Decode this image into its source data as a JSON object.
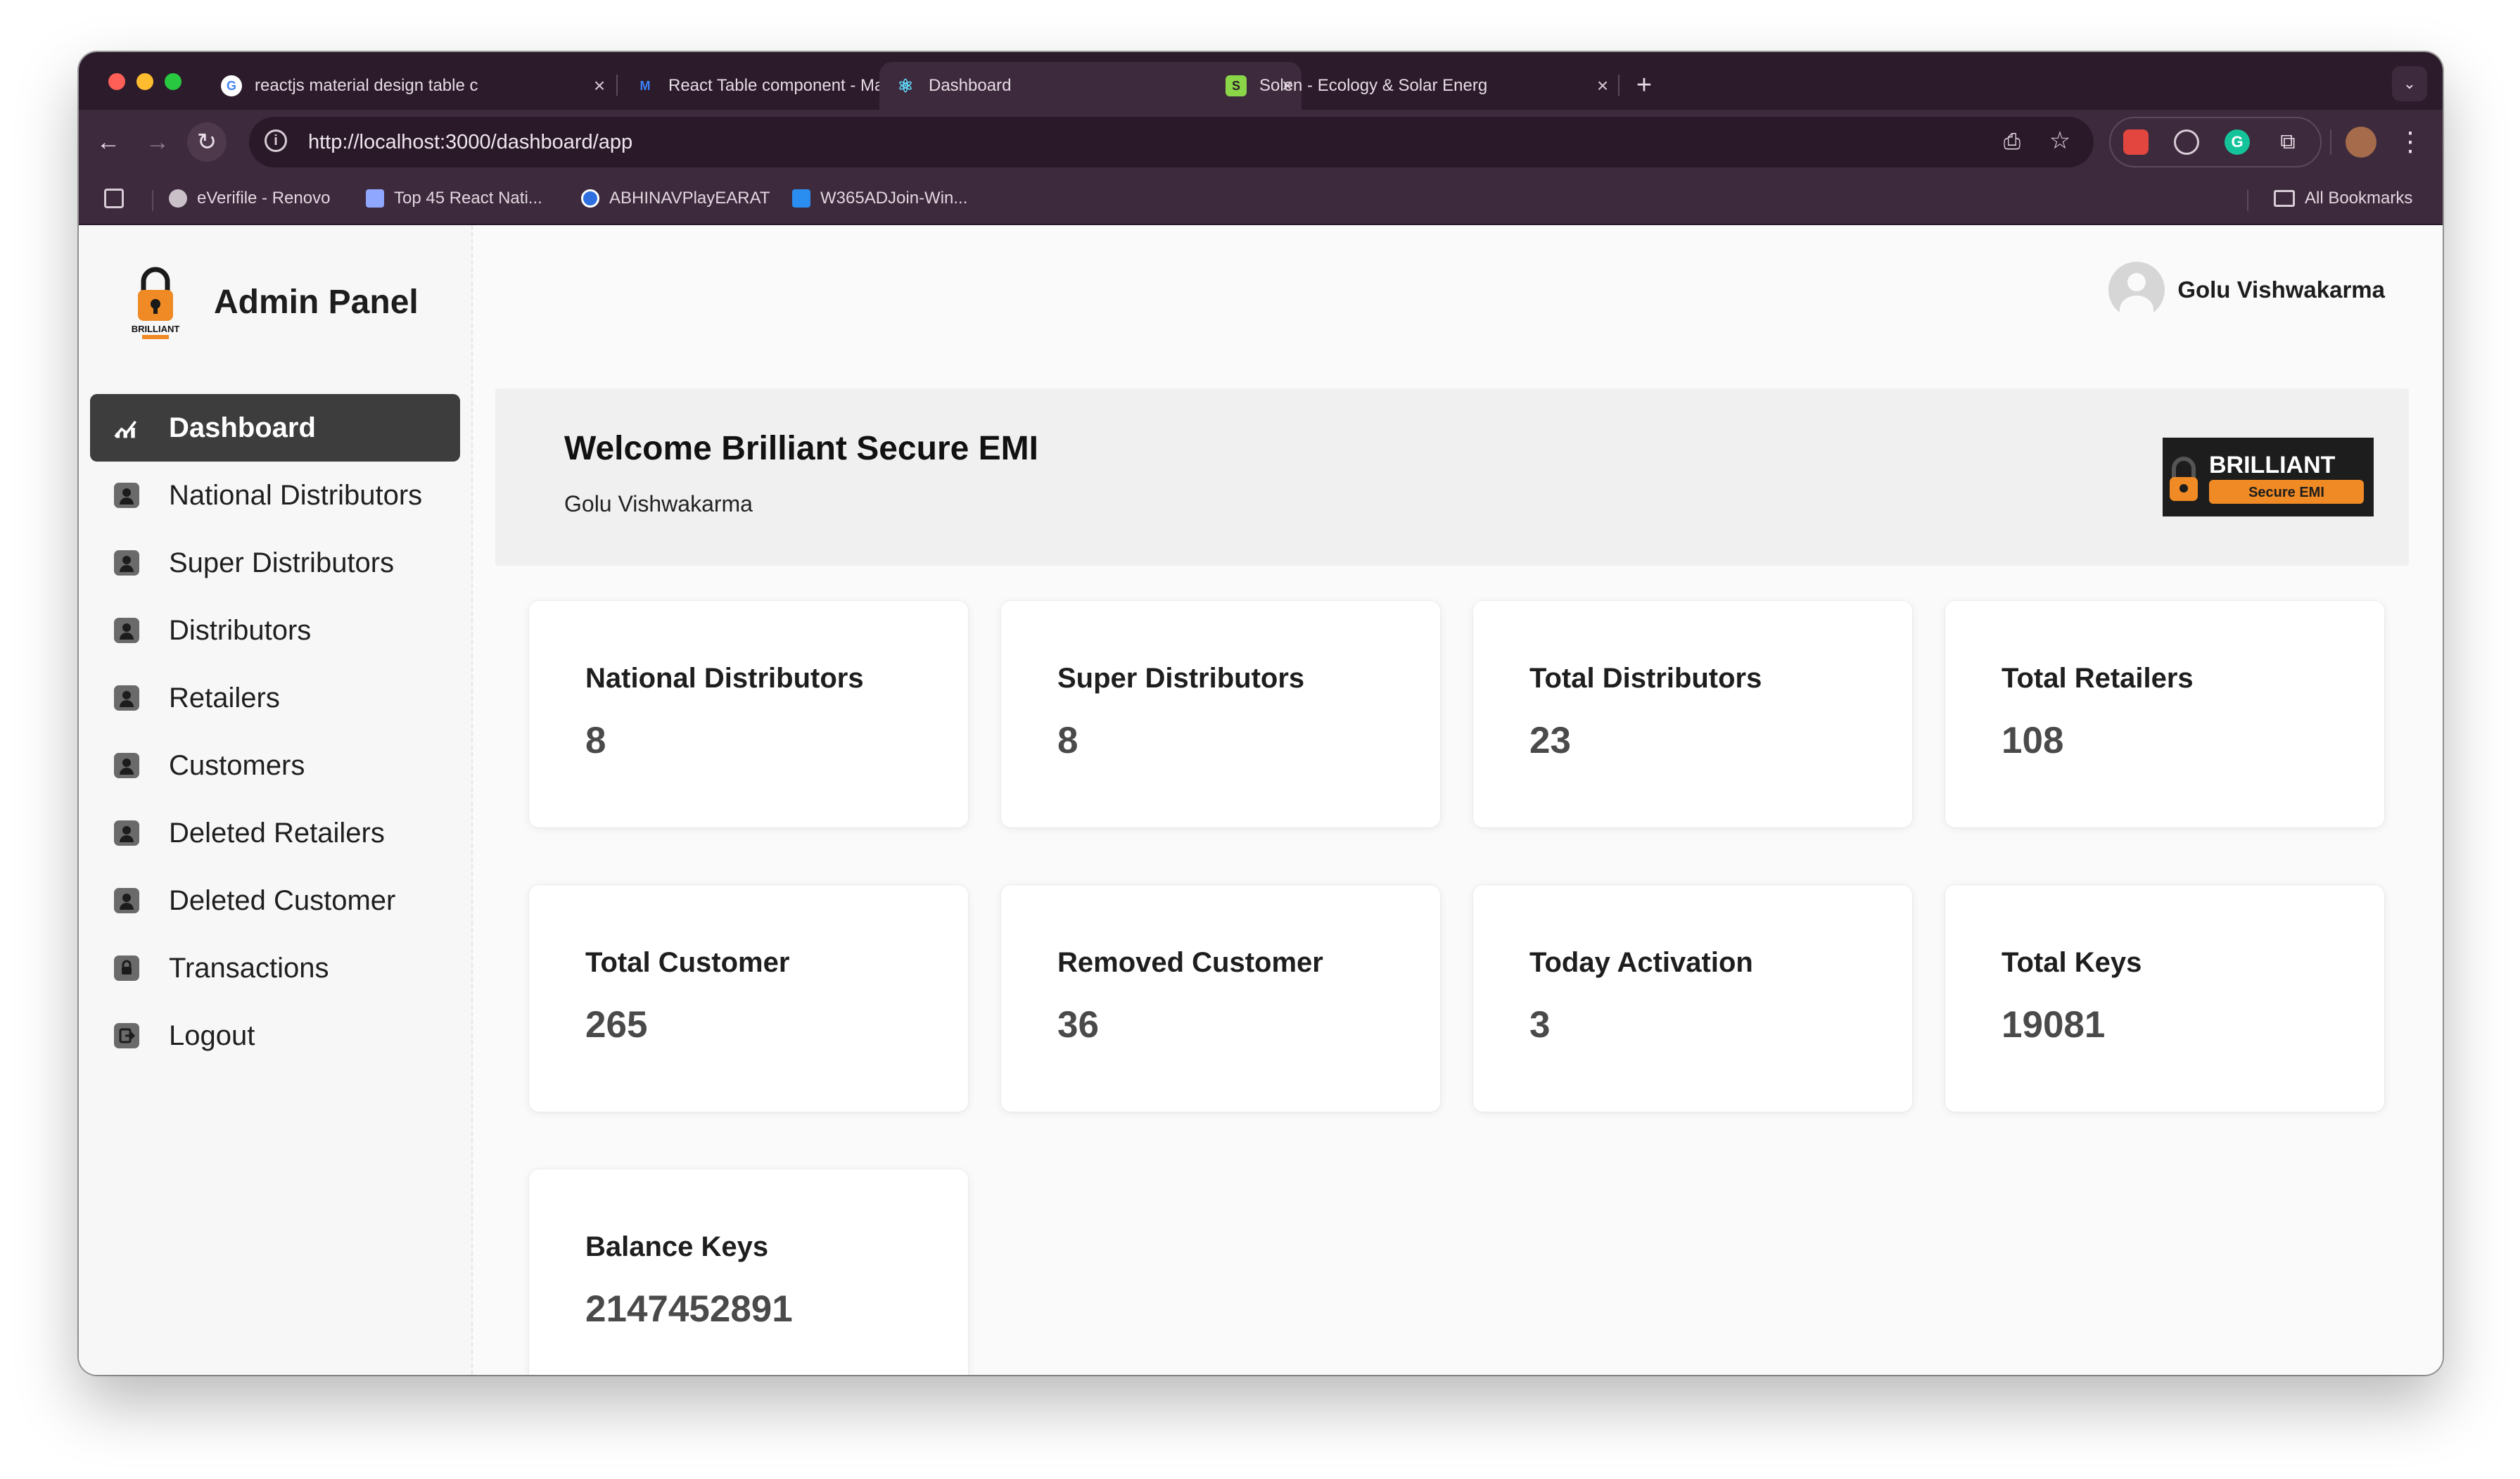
{
  "browser": {
    "tabs": [
      {
        "title": "reactjs material design table c",
        "favicon": "google-icon"
      },
      {
        "title": "React Table component - Mat",
        "favicon": "mui-icon"
      },
      {
        "title": "Dashboard",
        "favicon": "react-icon",
        "active": true
      },
      {
        "title": "Solen - Ecology & Solar Energ",
        "favicon": "solen-icon"
      }
    ],
    "url": "http://localhost:3000/dashboard/app",
    "bookmarks": [
      "eVerifile - Renovo",
      "Top 45 React Nati...",
      "ABHINAVPlayEARAT",
      "W365ADJoin-Win..."
    ],
    "all_bookmarks_label": "All Bookmarks"
  },
  "sidebar": {
    "title": "Admin Panel",
    "logo_text": "BRILLIANT",
    "items": [
      {
        "label": "Dashboard",
        "icon": "chart-icon",
        "active": true
      },
      {
        "label": "National Distributors",
        "icon": "person-icon"
      },
      {
        "label": "Super Distributors",
        "icon": "person-icon"
      },
      {
        "label": "Distributors",
        "icon": "person-icon"
      },
      {
        "label": "Retailers",
        "icon": "person-icon"
      },
      {
        "label": "Customers",
        "icon": "person-icon"
      },
      {
        "label": "Deleted Retailers",
        "icon": "person-icon"
      },
      {
        "label": "Deleted Customer",
        "icon": "person-icon"
      },
      {
        "label": "Transactions",
        "icon": "lock-icon"
      },
      {
        "label": "Logout",
        "icon": "logout-icon"
      }
    ]
  },
  "header": {
    "user_name": "Golu Vishwakarma"
  },
  "welcome": {
    "title": "Welcome Brilliant Secure EMI",
    "subtitle": "Golu Vishwakarma",
    "logo_brand": "BRILLIANT",
    "logo_tagline": "Secure EMI"
  },
  "stats": [
    {
      "label": "National Distributors",
      "value": "8"
    },
    {
      "label": "Super Distributors",
      "value": "8"
    },
    {
      "label": "Total Distributors",
      "value": "23"
    },
    {
      "label": "Total Retailers",
      "value": "108"
    },
    {
      "label": "Total Customer",
      "value": "265"
    },
    {
      "label": "Removed Customer",
      "value": "36"
    },
    {
      "label": "Today Activation",
      "value": "3"
    },
    {
      "label": "Total Keys",
      "value": "19081"
    },
    {
      "label": "Balance Keys",
      "value": "2147452891"
    }
  ]
}
